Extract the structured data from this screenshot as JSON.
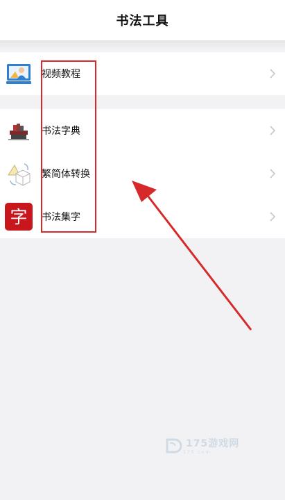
{
  "header": {
    "title": "书法工具"
  },
  "groups": [
    {
      "items": [
        {
          "label": "视频教程",
          "icon": "video-tutorial-icon"
        }
      ]
    },
    {
      "items": [
        {
          "label": "书法字典",
          "icon": "books-icon"
        },
        {
          "label": "繁简体转换",
          "icon": "shapes-convert-icon"
        },
        {
          "label": "书法集字",
          "icon": "zi-character-icon",
          "icon_char": "字"
        }
      ]
    }
  ],
  "annotation": {
    "color": "#d62a2a"
  },
  "watermark": {
    "brand": "175游戏网",
    "sub": "175.com"
  }
}
